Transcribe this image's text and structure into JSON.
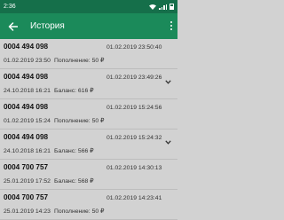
{
  "status_bar": {
    "time": "2:36"
  },
  "app_bar": {
    "title": "История"
  },
  "transactions": [
    {
      "account": "0004 494 098",
      "datetime_main": "01.02.2019 23:50:40",
      "datetime_sub": "01.02.2019 23:50",
      "info": "Пополнение: 50 ₽",
      "expandable": false
    },
    {
      "account": "0004 494 098",
      "datetime_main": "01.02.2019 23:49:26",
      "datetime_sub": "24.10.2018 16:21",
      "info": "Баланс: 616 ₽",
      "expandable": true
    },
    {
      "account": "0004 494 098",
      "datetime_main": "01.02.2019 15:24:56",
      "datetime_sub": "01.02.2019 15:24",
      "info": "Пополнение: 50 ₽",
      "expandable": false
    },
    {
      "account": "0004 494 098",
      "datetime_main": "01.02.2019 15:24:32",
      "datetime_sub": "24.10.2018 16:21",
      "info": "Баланс: 566 ₽",
      "expandable": true
    },
    {
      "account": "0004 700 757",
      "datetime_main": "01.02.2019 14:30:13",
      "datetime_sub": "25.01.2019 17:52",
      "info": "Баланс: 568 ₽",
      "expandable": false
    },
    {
      "account": "0004 700 757",
      "datetime_main": "01.02.2019 14:23:41",
      "datetime_sub": "25.01.2019 14:23",
      "info": "Пополнение: 50 ₽",
      "expandable": false
    }
  ]
}
